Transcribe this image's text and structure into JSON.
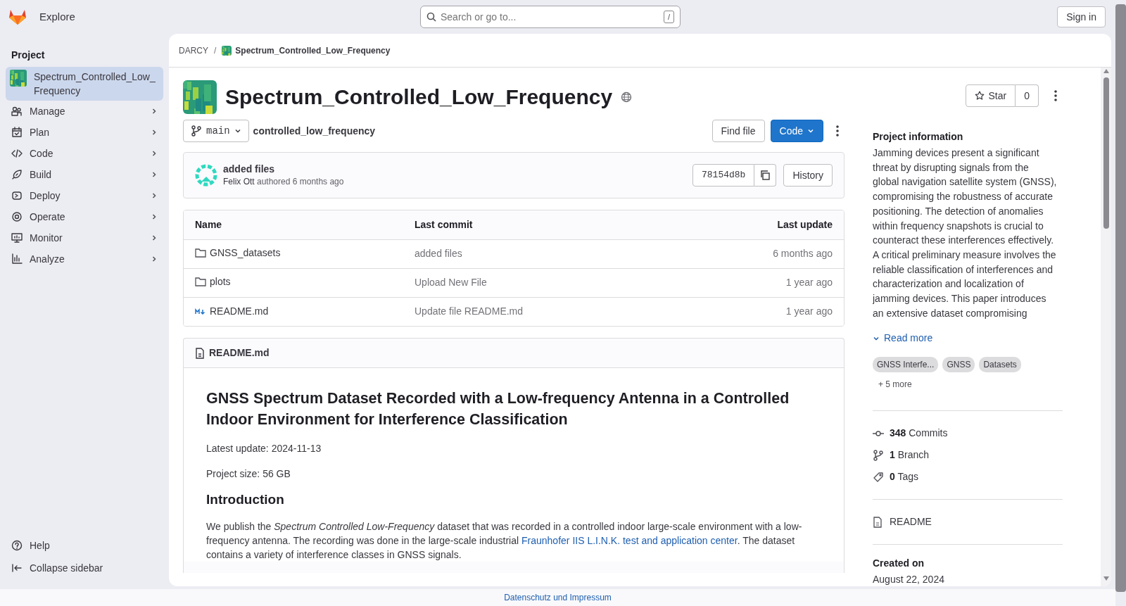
{
  "top_bar": {
    "explore": "Explore",
    "search": {
      "placeholder": "Search or go to...",
      "shortcut": "/"
    },
    "sign_in": "Sign in"
  },
  "sidebar": {
    "heading": "Project",
    "items": [
      {
        "kind": "project",
        "label": "Spectrum_Controlled_Low_Frequency",
        "selected": true
      },
      {
        "kind": "section",
        "label": "Manage",
        "selected": false
      },
      {
        "kind": "section",
        "label": "Plan",
        "selected": false
      },
      {
        "kind": "section",
        "label": "Code",
        "selected": false
      },
      {
        "kind": "section",
        "label": "Build",
        "selected": false
      },
      {
        "kind": "section",
        "label": "Deploy",
        "selected": false
      },
      {
        "kind": "section",
        "label": "Operate",
        "selected": false
      },
      {
        "kind": "section",
        "label": "Monitor",
        "selected": false
      },
      {
        "kind": "section",
        "label": "Analyze",
        "selected": false
      }
    ],
    "footer": [
      {
        "label": "Help"
      },
      {
        "label": "Collapse sidebar"
      }
    ]
  },
  "breadcrumb": [
    "DARCY",
    "/",
    "Spectrum_Controlled_Low_Frequency"
  ],
  "project": {
    "title": "Spectrum_Controlled_Low_Frequency",
    "star": "Star",
    "star_count": "0"
  },
  "repo_bar": {
    "branch": "main",
    "path": "controlled_low_frequency",
    "find_file": "Find file",
    "code": "Code"
  },
  "last_commit": {
    "message": "added files",
    "author": "Felix Ott",
    "meta": "authored 6 months ago",
    "sha": "78154d8b",
    "history": "History"
  },
  "table": {
    "columns": [
      "Name",
      "Last commit",
      "Last update"
    ],
    "rows": [
      {
        "kind": "folder",
        "name": "GNSS_datasets",
        "commit": "added files",
        "updated": "6 months ago"
      },
      {
        "kind": "folder",
        "name": "plots",
        "commit": "Upload New File",
        "updated": "1 year ago"
      },
      {
        "kind": "markdown",
        "name": "README.md",
        "commit": "Update file README.md",
        "updated": "1 year ago"
      }
    ]
  },
  "readme": {
    "file": "README.md",
    "heading": "GNSS Spectrum Dataset Recorded with a Low-frequency Antenna in a Controlled Indoor Environment for Interference Classification",
    "blocks": [
      {
        "kind": "p",
        "text": "Latest update: 2024-11-13"
      },
      {
        "kind": "p",
        "text": "Project size: 56 GB"
      },
      {
        "kind": "h2",
        "text": "Introduction"
      },
      {
        "kind": "p",
        "text": "We publish the *Spectrum Controlled Low-Frequency* dataset that was recorded in a controlled indoor large-scale environment with a low-frequency antenna. The recording was done in the large-scale industrial ",
        "link": "Fraunhofer IIS L.I.N.K. test and application center",
        "after": ". The dataset contains a variety of interference classes in GNSS signals."
      }
    ]
  },
  "project_info": {
    "heading": "Project information",
    "description": "Jamming devices present a significant threat by disrupting signals from the global navigation satellite system (GNSS), compromising the robustness of accurate positioning. The detection of anomalies within frequency snapshots is crucial to counteract these interferences effectively. A critical preliminary measure involves the reliable classification of interferences and characterization and localization of jamming devices. This paper introduces an extensive dataset compromising",
    "read_more": "Read more",
    "topics": [
      "GNSS Interfe...",
      "GNSS",
      "Datasets"
    ],
    "more_topics": "+ 5 more",
    "stats": [
      {
        "count": "348",
        "label": "Commits"
      },
      {
        "count": "1",
        "label": "Branch"
      },
      {
        "count": "0",
        "label": "Tags"
      }
    ],
    "readme_link": "README",
    "created_label": "Created on",
    "created_date": "August 22, 2024"
  },
  "footer": "Datenschutz und Impressum"
}
